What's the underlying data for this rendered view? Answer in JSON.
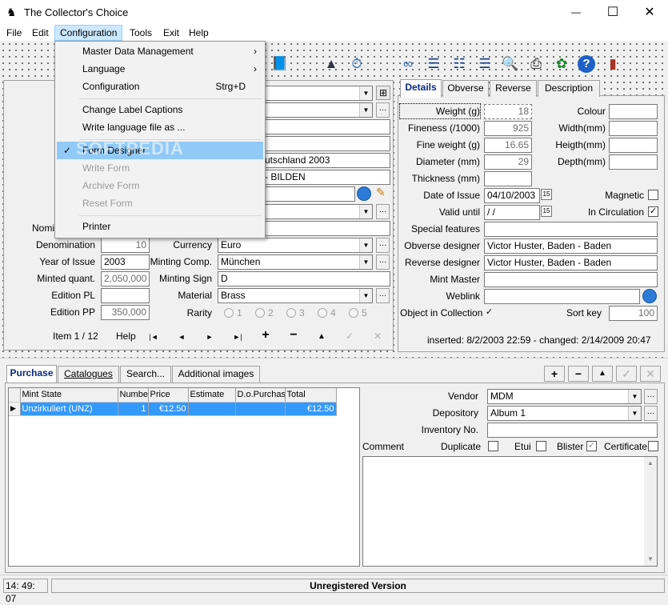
{
  "window": {
    "title": "The Collector's Choice",
    "minimize": "—",
    "maximize": "☐",
    "close": "✕"
  },
  "menubar": [
    "File",
    "Edit",
    "Configuration",
    "Tools",
    "Exit",
    "Help"
  ],
  "config_menu": {
    "items": [
      {
        "label": "Master Data Management",
        "arrow": "›"
      },
      {
        "label": "Language",
        "arrow": "›"
      },
      {
        "label": "Configuration",
        "shortcut": "Strg+D"
      },
      {
        "label": "Change Label Captions"
      },
      {
        "label": "Write language file as ..."
      },
      {
        "label": "Form Designer",
        "check": "✓"
      },
      {
        "label": "Write Form"
      },
      {
        "label": "Archive Form"
      },
      {
        "label": "Reset Form"
      },
      {
        "label": "Printer"
      }
    ]
  },
  "left": {
    "peek": [
      "utschland 2003",
      "- BILDEN"
    ],
    "nominal_label": "Nomi",
    "denomination": {
      "label": "Denomination",
      "value": "10"
    },
    "year": {
      "label": "Year of Issue",
      "value": "2003"
    },
    "minted": {
      "label": "Minted quant.",
      "value": "2,050,000"
    },
    "edpl": {
      "label": "Edition PL",
      "value": ""
    },
    "edpp": {
      "label": "Edition PP",
      "value": "350,000"
    },
    "currency": {
      "label": "Currency",
      "value": "Euro"
    },
    "mintcomp": {
      "label": "Minting Comp.",
      "value": "München"
    },
    "mintsign": {
      "label": "Minting Sign",
      "value": "D"
    },
    "material": {
      "label": "Material",
      "value": "Brass"
    },
    "rarity": {
      "label": "Rarity",
      "options": [
        "1",
        "2",
        "3",
        "4",
        "5"
      ]
    },
    "nav": {
      "item": "Item 1 / 12",
      "help": "Help",
      "first": "|◄",
      "prev": "◄",
      "next": "►",
      "last": "►|",
      "add": "+",
      "del": "−",
      "up": "▲",
      "ok": "✓",
      "cancel": "✕"
    }
  },
  "details": {
    "tabs": [
      "Details",
      "Obverse",
      "Reverse",
      "Description"
    ],
    "weight": {
      "label": "Weight (g)",
      "value": "18"
    },
    "fineness": {
      "label": "Fineness (/1000)",
      "value": "925"
    },
    "fineweight": {
      "label": "Fine weight (g)",
      "value": "16.65"
    },
    "diameter": {
      "label": "Diameter (mm)",
      "value": "29"
    },
    "thickness": {
      "label": "Thickness (mm)",
      "value": ""
    },
    "colour": {
      "label": "Colour",
      "value": ""
    },
    "width": {
      "label": "Width(mm)",
      "value": ""
    },
    "height": {
      "label": "Heigth(mm)",
      "value": ""
    },
    "depth": {
      "label": "Depth(mm)",
      "value": ""
    },
    "date_issue": {
      "label": "Date of Issue",
      "value": "04/10/2003",
      "cal": "15"
    },
    "valid_until": {
      "label": "Valid until",
      "value": " /  /",
      "cal": "15"
    },
    "magnetic": {
      "label": "Magnetic",
      "check": ""
    },
    "circulation": {
      "label": "In Circulation",
      "check": "✓"
    },
    "special": {
      "label": "Special features",
      "value": ""
    },
    "obv_designer": {
      "label": "Obverse designer",
      "value": "Victor Huster, Baden - Baden"
    },
    "rev_designer": {
      "label": "Reverse designer",
      "value": "Victor Huster, Baden - Baden"
    },
    "mint_master": {
      "label": "Mint Master",
      "value": ""
    },
    "weblink": {
      "label": "Weblink",
      "value": ""
    },
    "in_collection": {
      "label": "Object in Collection",
      "check": "✓"
    },
    "sort_key": {
      "label": "Sort key",
      "value": "100"
    },
    "timestamps": "inserted: 8/2/2003 22:59 - changed: 2/14/2009 20:47"
  },
  "bottom": {
    "tabs": [
      "Purchase",
      "Catalogues",
      "Search...",
      "Additional images"
    ],
    "grid": {
      "headers": [
        "Mint State",
        "Numbe",
        "Price",
        "Estimate",
        "D.o.Purchas",
        "Total"
      ],
      "rows": [
        [
          "Unzirkuliert (UNZ)",
          "1",
          "€12.50",
          "",
          "",
          "€12.50"
        ]
      ]
    },
    "btns": {
      "add": "+",
      "del": "−",
      "up": "▲",
      "ok": "✓",
      "cancel": "✕"
    },
    "vendor": {
      "label": "Vendor",
      "value": "MDM"
    },
    "depository": {
      "label": "Depository",
      "value": "Album 1"
    },
    "inventory": {
      "label": "Inventory No.",
      "value": ""
    },
    "comment": "Comment",
    "duplicate": "Duplicate",
    "etui": "Etui",
    "blister": {
      "label": "Blister",
      "check": "✓"
    },
    "certificate": "Certificate"
  },
  "status": {
    "time": "14: 49: 07",
    "text": "Unregistered Version"
  },
  "watermark": "SOFTPEDIA"
}
